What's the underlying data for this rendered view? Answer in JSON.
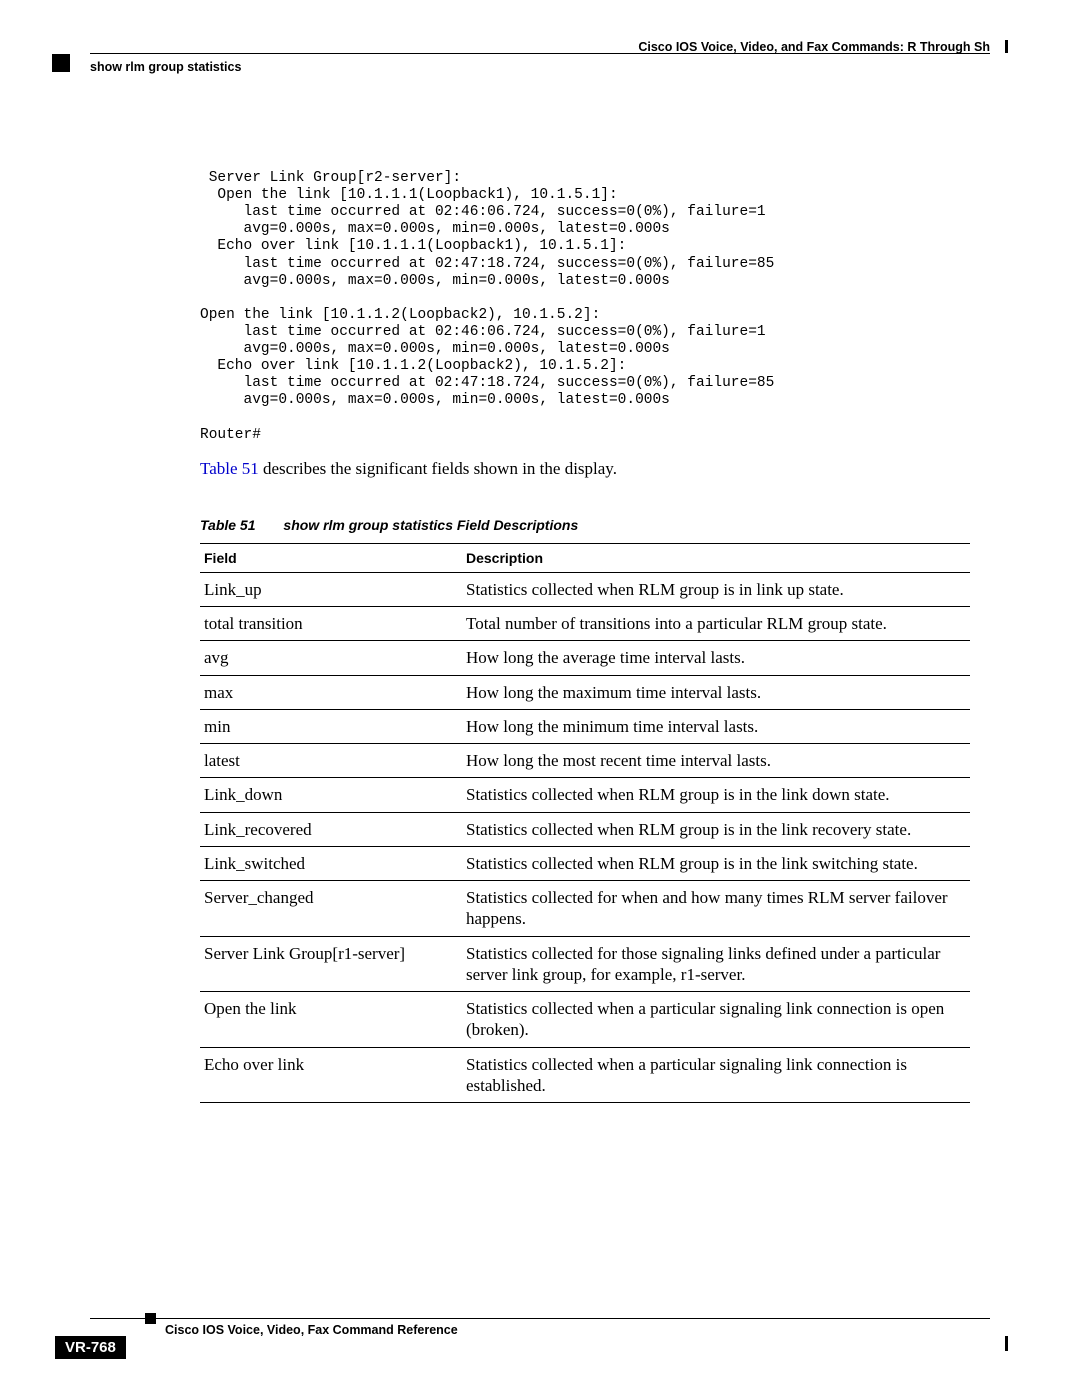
{
  "header": {
    "right": "Cisco IOS Voice, Video, and Fax Commands: R Through Sh",
    "left": "show rlm group statistics"
  },
  "code": " Server Link Group[r2-server]:\n  Open the link [10.1.1.1(Loopback1), 10.1.5.1]:\n     last time occurred at 02:46:06.724, success=0(0%), failure=1\n     avg=0.000s, max=0.000s, min=0.000s, latest=0.000s\n  Echo over link [10.1.1.1(Loopback1), 10.1.5.1]:\n     last time occurred at 02:47:18.724, success=0(0%), failure=85\n     avg=0.000s, max=0.000s, min=0.000s, latest=0.000s\n\nOpen the link [10.1.1.2(Loopback2), 10.1.5.2]:\n     last time occurred at 02:46:06.724, success=0(0%), failure=1\n     avg=0.000s, max=0.000s, min=0.000s, latest=0.000s\n  Echo over link [10.1.1.2(Loopback2), 10.1.5.2]:\n     last time occurred at 02:47:18.724, success=0(0%), failure=85\n     avg=0.000s, max=0.000s, min=0.000s, latest=0.000s\n\nRouter#",
  "intro": {
    "ref": "Table 51",
    "text": " describes the significant fields shown in the display."
  },
  "caption": {
    "label": "Table 51",
    "title": "show rlm group statistics Field Descriptions"
  },
  "table": {
    "head": {
      "field": "Field",
      "desc": "Description"
    },
    "rows": [
      {
        "field": "Link_up",
        "desc": "Statistics collected when RLM group is in link up state."
      },
      {
        "field": "total transition",
        "desc": "Total number of transitions into a particular RLM group state."
      },
      {
        "field": "avg",
        "desc": "How long the average time interval lasts."
      },
      {
        "field": "max",
        "desc": "How long the maximum time interval lasts."
      },
      {
        "field": "min",
        "desc": "How long the minimum time interval lasts."
      },
      {
        "field": "latest",
        "desc": "How long the most recent time interval lasts."
      },
      {
        "field": "Link_down",
        "desc": "Statistics collected when RLM group is in the link down state."
      },
      {
        "field": "Link_recovered",
        "desc": "Statistics collected when RLM group is in the link recovery state."
      },
      {
        "field": "Link_switched",
        "desc": "Statistics collected when RLM group is in the link switching state."
      },
      {
        "field": "Server_changed",
        "desc": "Statistics collected for when and how many times RLM server failover happens."
      },
      {
        "field": "Server Link Group[r1-server]",
        "desc": "Statistics collected for those signaling links defined under a particular server link group, for example, r1-server."
      },
      {
        "field": "Open the link",
        "desc": "Statistics collected when a particular signaling link connection is open (broken)."
      },
      {
        "field": "Echo over link",
        "desc": "Statistics collected when a particular signaling link connection is established."
      }
    ]
  },
  "footer": {
    "title": "Cisco IOS Voice, Video, Fax Command Reference",
    "page": "VR-768"
  }
}
